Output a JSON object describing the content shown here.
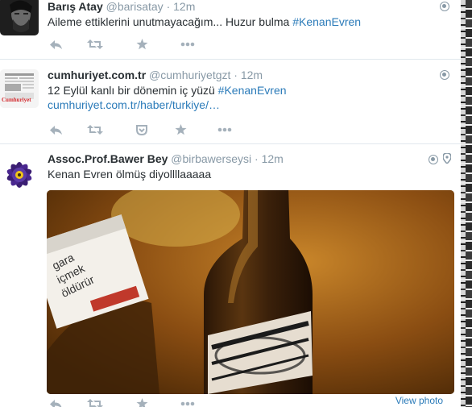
{
  "tweets": [
    {
      "fullname": "Barış Atay",
      "username": "@barisatay",
      "separator": "·",
      "time": "12m",
      "text": "Aileme ettiklerini unutmayacağım... Huzur bulma ",
      "hashtag": "#KenanEvren"
    },
    {
      "fullname": "cumhuriyet.com.tr",
      "username": "@cumhuriyetgzt",
      "separator": "·",
      "time": "12m",
      "text": "12 Eylül kanlı bir dönemin iç yüzü ",
      "hashtag": "#KenanEvren",
      "link": "cumhuriyet.com.tr/haber/turkiye/…",
      "avatar_label": "Cumhuriyet"
    },
    {
      "fullname": "Assoc.Prof.Bawer Bey",
      "username": "@birbawerseysi",
      "separator": "·",
      "time": "12m",
      "text": "Kenan Evren ölmüş diyollllaaaaa",
      "view_photo": "View photo"
    }
  ],
  "colors": {
    "link_blue": "#2b7bb9",
    "meta_gray": "#8899a6",
    "text_dark": "#292f33",
    "icon_gray": "#a5b1bb"
  },
  "icons": {
    "reply": "reply-icon",
    "retweet": "retweet-icon",
    "favorite": "star-icon",
    "more": "more-icon",
    "pocket": "pocket-icon",
    "globe": "globe-icon",
    "location": "location-pin-icon"
  }
}
